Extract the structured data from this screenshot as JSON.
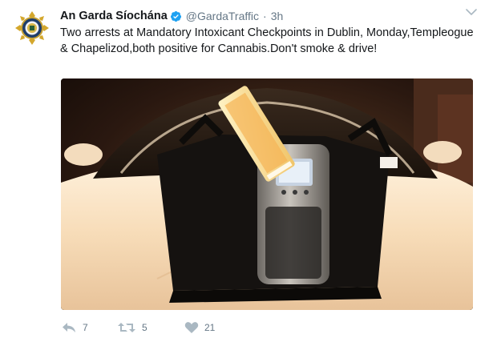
{
  "tweet": {
    "author_name": "An Garda Síochána",
    "handle": "@GardaTraffic",
    "separator": "·",
    "time": "3h",
    "text": "Two arrests at Mandatory Intoxicant Checkpoints in Dublin, Monday,Templeogue & Chapelizod,both positive for Cannabis.Don't smoke & drive!",
    "icons": {
      "avatar": "garda-badge-avatar",
      "verified": "verified-badge-icon",
      "more": "chevron-down-icon",
      "reply": "reply-icon",
      "retweet": "retweet-icon",
      "like": "heart-icon"
    },
    "media_description_icon": "photo",
    "actions": {
      "reply_count": "7",
      "retweet_count": "5",
      "like_count": "21"
    },
    "colors": {
      "verified": "#1da1f2",
      "secondary_text": "#657786",
      "action_icon": "#aab8c2"
    }
  }
}
